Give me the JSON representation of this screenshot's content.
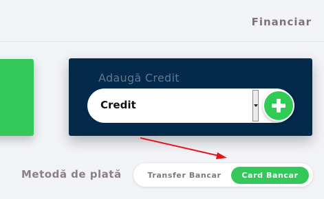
{
  "header": {
    "section_title": "Financiar"
  },
  "credit_panel": {
    "title": "Adaugă Credit",
    "select": {
      "selected_value": "Credit"
    },
    "add_button_icon": "plus-icon"
  },
  "payment": {
    "label": "Metodă de plată",
    "options": [
      {
        "label": "Transfer Bancar",
        "selected": false
      },
      {
        "label": "Card Bancar",
        "selected": true
      }
    ]
  },
  "colors": {
    "accent_green": "#34c759",
    "panel_navy": "#032a4a",
    "annotation_red": "#e0151b"
  }
}
